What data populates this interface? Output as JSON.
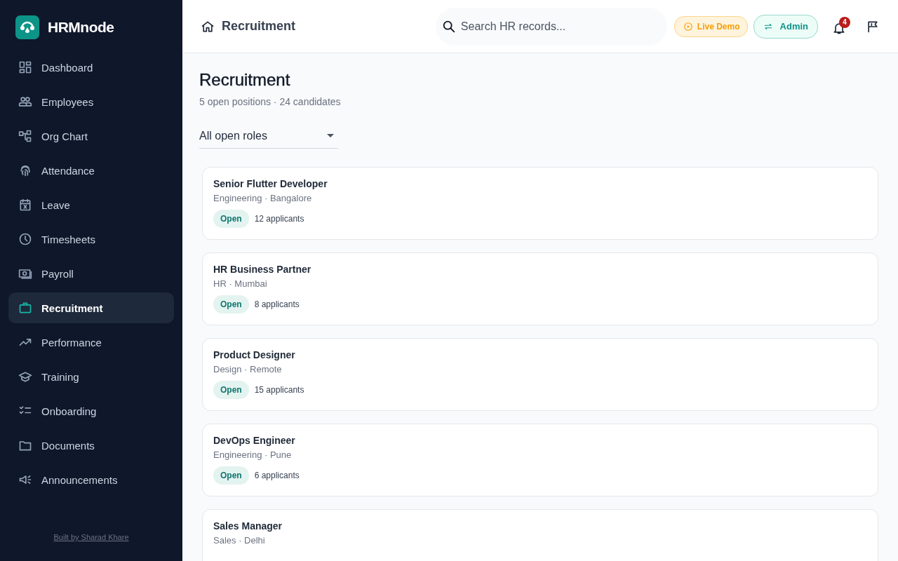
{
  "sidebar": {
    "brand": "HRMnode",
    "items": [
      {
        "label": "Dashboard",
        "selected": false
      },
      {
        "label": "Employees",
        "selected": false
      },
      {
        "label": "Org Chart",
        "selected": false
      },
      {
        "label": "Attendance",
        "selected": false
      },
      {
        "label": "Leave",
        "selected": false
      },
      {
        "label": "Timesheets",
        "selected": false
      },
      {
        "label": "Payroll",
        "selected": false
      },
      {
        "label": "Recruitment",
        "selected": true
      },
      {
        "label": "Performance",
        "selected": false
      },
      {
        "label": "Training",
        "selected": false
      },
      {
        "label": "Onboarding",
        "selected": false
      },
      {
        "label": "Documents",
        "selected": false
      },
      {
        "label": "Announcements",
        "selected": false
      }
    ],
    "footer_link": "Built by Sharad Khare"
  },
  "header": {
    "breadcrumb": "Recruitment",
    "search": {
      "placeholder": "Search HR records..."
    },
    "live_demo": "Live Demo",
    "role": "Admin",
    "notification_count": "4"
  },
  "page": {
    "title": "Recruitment",
    "subtitle": "5 open positions · 24 candidates",
    "filter": "All open roles",
    "jobs": [
      {
        "title": "Senior Flutter Developer",
        "meta": "Engineering · Bangalore",
        "status": "Open",
        "applicants": "12 applicants"
      },
      {
        "title": "HR Business Partner",
        "meta": "HR · Mumbai",
        "status": "Open",
        "applicants": "8 applicants"
      },
      {
        "title": "Product Designer",
        "meta": "Design · Remote",
        "status": "Open",
        "applicants": "15 applicants"
      },
      {
        "title": "DevOps Engineer",
        "meta": "Engineering · Pune",
        "status": "Open",
        "applicants": "6 applicants"
      },
      {
        "title": "Sales Manager",
        "meta": "Sales · Delhi"
      }
    ]
  }
}
